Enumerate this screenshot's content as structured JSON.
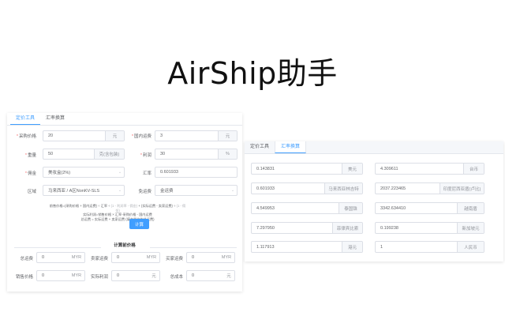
{
  "hero_title": "AirShip助手",
  "left_panel": {
    "tabs": [
      "定价工具",
      "汇率换算"
    ],
    "fields": {
      "purchase_price": {
        "label": "采购价格",
        "value": "20",
        "suffix": "元"
      },
      "domestic_shipping": {
        "label": "国内运费",
        "value": "3",
        "suffix": "元"
      },
      "weight": {
        "label": "重量",
        "value": "50",
        "suffix": "克(含包装)"
      },
      "profit": {
        "label": "利润",
        "value": "30",
        "suffix": "%"
      },
      "commission": {
        "label": "佣金",
        "value": "美妆盒(2%)"
      },
      "exchange_rate": {
        "label": "汇率",
        "value": "0.601933"
      },
      "region": {
        "label": "区域",
        "value": "马来西亚 / A区NonKV-SLS"
      },
      "free_shipping": {
        "label": "免运费",
        "value": "金运费"
      }
    },
    "formula": {
      "line1_a": "前售价格=(采购价格 + 国内运费) ÷ 汇率 ÷ ",
      "line1_gray": "(1 - 利润率 - 佣金)",
      "line1_b": " + (实际运费 - 卖家运费) ÷ ",
      "line1_gray2": "(1 - 佣金)",
      "line2": "实际利润=销售价格 × 汇率-采购价格 - 国内运费",
      "line3": "总运费 = 实际运费 + 卖家运费 (填充器价的总运费)"
    },
    "calc_button": "计算",
    "result_section": "计算前价格",
    "results": {
      "total_shipping": {
        "label": "总运费",
        "value": "0",
        "suffix": "MYR"
      },
      "seller_shipping": {
        "label": "卖家运费",
        "value": "0",
        "suffix": "MYR"
      },
      "buyer_shipping": {
        "label": "买家运费",
        "value": "0",
        "suffix": "MYR"
      },
      "sale_price": {
        "label": "销售价格",
        "value": "0",
        "suffix": "MYR"
      },
      "actual_profit": {
        "label": "实际利润",
        "value": "0",
        "suffix": "元"
      },
      "total_cost": {
        "label": "总成本",
        "value": "0",
        "suffix": "元"
      }
    }
  },
  "right_panel": {
    "tabs": [
      "定价工具",
      "汇率换算"
    ],
    "rows": [
      {
        "left_value": "0.143831",
        "left_unit": "美元",
        "right_value": "4.309611",
        "right_unit": "台币"
      },
      {
        "left_value": "0.601933",
        "left_unit": "马来西亚林吉特",
        "right_value": "2037.223465",
        "right_unit": "印度尼西亚盾(卢比)"
      },
      {
        "left_value": "4.549953",
        "left_unit": "泰国铢",
        "right_value": "3342.634410",
        "right_unit": "越南盾"
      },
      {
        "left_value": "7.297950",
        "left_unit": "菲律宾比索",
        "right_value": "0.199238",
        "right_unit": "新加坡元"
      },
      {
        "left_value": "1.117913",
        "left_unit": "港元",
        "right_value": "1",
        "right_unit": "人民币"
      }
    ]
  }
}
